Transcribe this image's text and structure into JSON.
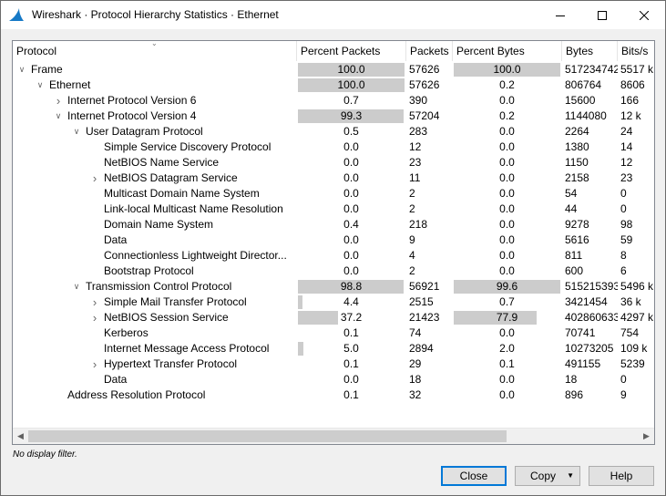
{
  "window": {
    "title": "Wireshark · Protocol Hierarchy Statistics · Ethernet",
    "app_icon": "wireshark-fin-icon"
  },
  "columns": [
    "Protocol",
    "Percent Packets",
    "Packets",
    "Percent Bytes",
    "Bytes",
    "Bits/s"
  ],
  "rows": [
    {
      "protocol": "Frame",
      "depth": 0,
      "expander": "expanded",
      "percent_packets": "100.0",
      "packets": "57626",
      "percent_bytes": "100.0",
      "bytes": "517234742",
      "bits_s": "5517 k",
      "pp_fill": 100,
      "pb_fill": 100
    },
    {
      "protocol": "Ethernet",
      "depth": 1,
      "expander": "expanded",
      "percent_packets": "100.0",
      "packets": "57626",
      "percent_bytes": "0.2",
      "bytes": "806764",
      "bits_s": "8606",
      "pp_fill": 100,
      "pb_fill": 0
    },
    {
      "protocol": "Internet Protocol Version 6",
      "depth": 2,
      "expander": "collapsed",
      "percent_packets": "0.7",
      "packets": "390",
      "percent_bytes": "0.0",
      "bytes": "15600",
      "bits_s": "166",
      "pp_fill": 0,
      "pb_fill": 0
    },
    {
      "protocol": "Internet Protocol Version 4",
      "depth": 2,
      "expander": "expanded",
      "percent_packets": "99.3",
      "packets": "57204",
      "percent_bytes": "0.2",
      "bytes": "1144080",
      "bits_s": "12 k",
      "pp_fill": 99.3,
      "pb_fill": 0
    },
    {
      "protocol": "User Datagram Protocol",
      "depth": 3,
      "expander": "expanded",
      "percent_packets": "0.5",
      "packets": "283",
      "percent_bytes": "0.0",
      "bytes": "2264",
      "bits_s": "24",
      "pp_fill": 0,
      "pb_fill": 0
    },
    {
      "protocol": "Simple Service Discovery Protocol",
      "depth": 4,
      "expander": "none",
      "percent_packets": "0.0",
      "packets": "12",
      "percent_bytes": "0.0",
      "bytes": "1380",
      "bits_s": "14",
      "pp_fill": 0,
      "pb_fill": 0
    },
    {
      "protocol": "NetBIOS Name Service",
      "depth": 4,
      "expander": "none",
      "percent_packets": "0.0",
      "packets": "23",
      "percent_bytes": "0.0",
      "bytes": "1150",
      "bits_s": "12",
      "pp_fill": 0,
      "pb_fill": 0
    },
    {
      "protocol": "NetBIOS Datagram Service",
      "depth": 4,
      "expander": "collapsed",
      "percent_packets": "0.0",
      "packets": "11",
      "percent_bytes": "0.0",
      "bytes": "2158",
      "bits_s": "23",
      "pp_fill": 0,
      "pb_fill": 0
    },
    {
      "protocol": "Multicast Domain Name System",
      "depth": 4,
      "expander": "none",
      "percent_packets": "0.0",
      "packets": "2",
      "percent_bytes": "0.0",
      "bytes": "54",
      "bits_s": "0",
      "pp_fill": 0,
      "pb_fill": 0
    },
    {
      "protocol": "Link-local Multicast Name Resolution",
      "depth": 4,
      "expander": "none",
      "percent_packets": "0.0",
      "packets": "2",
      "percent_bytes": "0.0",
      "bytes": "44",
      "bits_s": "0",
      "pp_fill": 0,
      "pb_fill": 0
    },
    {
      "protocol": "Domain Name System",
      "depth": 4,
      "expander": "none",
      "percent_packets": "0.4",
      "packets": "218",
      "percent_bytes": "0.0",
      "bytes": "9278",
      "bits_s": "98",
      "pp_fill": 0,
      "pb_fill": 0
    },
    {
      "protocol": "Data",
      "depth": 4,
      "expander": "none",
      "percent_packets": "0.0",
      "packets": "9",
      "percent_bytes": "0.0",
      "bytes": "5616",
      "bits_s": "59",
      "pp_fill": 0,
      "pb_fill": 0
    },
    {
      "protocol": "Connectionless Lightweight Director...",
      "depth": 4,
      "expander": "none",
      "percent_packets": "0.0",
      "packets": "4",
      "percent_bytes": "0.0",
      "bytes": "811",
      "bits_s": "8",
      "pp_fill": 0,
      "pb_fill": 0
    },
    {
      "protocol": "Bootstrap Protocol",
      "depth": 4,
      "expander": "none",
      "percent_packets": "0.0",
      "packets": "2",
      "percent_bytes": "0.0",
      "bytes": "600",
      "bits_s": "6",
      "pp_fill": 0,
      "pb_fill": 0
    },
    {
      "protocol": "Transmission Control Protocol",
      "depth": 3,
      "expander": "expanded",
      "percent_packets": "98.8",
      "packets": "56921",
      "percent_bytes": "99.6",
      "bytes": "515215393",
      "bits_s": "5496 k",
      "pp_fill": 98.8,
      "pb_fill": 99.6
    },
    {
      "protocol": "Simple Mail Transfer Protocol",
      "depth": 4,
      "expander": "collapsed",
      "percent_packets": "4.4",
      "packets": "2515",
      "percent_bytes": "0.7",
      "bytes": "3421454",
      "bits_s": "36 k",
      "pp_fill": 4.4,
      "pb_fill": 0
    },
    {
      "protocol": "NetBIOS Session Service",
      "depth": 4,
      "expander": "collapsed",
      "percent_packets": "37.2",
      "packets": "21423",
      "percent_bytes": "77.9",
      "bytes": "402860633",
      "bits_s": "4297 k",
      "pp_fill": 37.2,
      "pb_fill": 77.9
    },
    {
      "protocol": "Kerberos",
      "depth": 4,
      "expander": "none",
      "percent_packets": "0.1",
      "packets": "74",
      "percent_bytes": "0.0",
      "bytes": "70741",
      "bits_s": "754",
      "pp_fill": 0,
      "pb_fill": 0
    },
    {
      "protocol": "Internet Message Access Protocol",
      "depth": 4,
      "expander": "none",
      "percent_packets": "5.0",
      "packets": "2894",
      "percent_bytes": "2.0",
      "bytes": "10273205",
      "bits_s": "109 k",
      "pp_fill": 5.0,
      "pb_fill": 0
    },
    {
      "protocol": "Hypertext Transfer Protocol",
      "depth": 4,
      "expander": "collapsed",
      "percent_packets": "0.1",
      "packets": "29",
      "percent_bytes": "0.1",
      "bytes": "491155",
      "bits_s": "5239",
      "pp_fill": 0,
      "pb_fill": 0
    },
    {
      "protocol": "Data",
      "depth": 4,
      "expander": "none",
      "percent_packets": "0.0",
      "packets": "18",
      "percent_bytes": "0.0",
      "bytes": "18",
      "bits_s": "0",
      "pp_fill": 0,
      "pb_fill": 0
    },
    {
      "protocol": "Address Resolution Protocol",
      "depth": 2,
      "expander": "none",
      "percent_packets": "0.1",
      "packets": "32",
      "percent_bytes": "0.0",
      "bytes": "896",
      "bits_s": "9",
      "pp_fill": 0,
      "pb_fill": 0
    }
  ],
  "status": "No display filter.",
  "buttons": {
    "close": "Close",
    "copy": "Copy",
    "help": "Help"
  },
  "colors": {
    "bar": "#cccccc",
    "default_button_border": "#0078d7"
  }
}
